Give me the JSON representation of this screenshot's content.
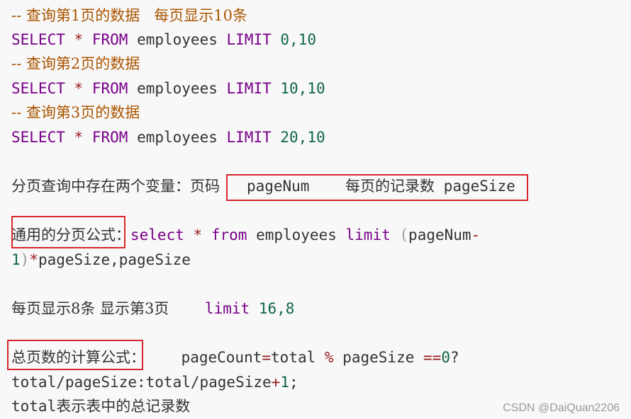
{
  "code": {
    "comment1": "-- 查询第1页的数据   每页显示10条",
    "comment2": "-- 查询第2页的数据",
    "comment3": "-- 查询第3页的数据",
    "select_kw": "SELECT",
    "star": "*",
    "from_kw": "FROM",
    "table": "employees",
    "limit_kw": "LIMIT",
    "limit1": "0,10",
    "limit2": "10,10",
    "limit3": "20,10"
  },
  "vars_line": {
    "label": "分页查询中存在两个变量：页码",
    "page_num": "pageNum",
    "size_label": "每页的记录数",
    "page_size": "pageSize"
  },
  "formula": {
    "label": "通用的分页公式",
    "colon": "：",
    "select_kw": "select",
    "star": "*",
    "from_kw": "from",
    "table": "employees",
    "limit_kw": "limit",
    "paren_open": "(",
    "page_num": "pageNum",
    "minus": "-",
    "one": "1",
    "paren_close": ")",
    "times": "*",
    "rest": "pageSize,pageSize"
  },
  "example": {
    "label": "每页显示8条 显示第3页",
    "limit_kw": "limit",
    "values": "16,8"
  },
  "total": {
    "label": "总页数的计算公式：",
    "page_count": "pageCount",
    "eq": "=",
    "total": "total",
    "mod": "%",
    "page_size": "pageSize",
    "eqeq": "==",
    "zero": "0",
    "question": "?",
    "line2_a": "total/pageSize:total/pageSize",
    "plus": "+",
    "line2_one": "1",
    "semicolon": ";",
    "line3_code": "total",
    "line3_text": "表示表中的总记录数"
  },
  "watermark": "CSDN @DaiQuan2206",
  "highlight_color": "#d9262c"
}
